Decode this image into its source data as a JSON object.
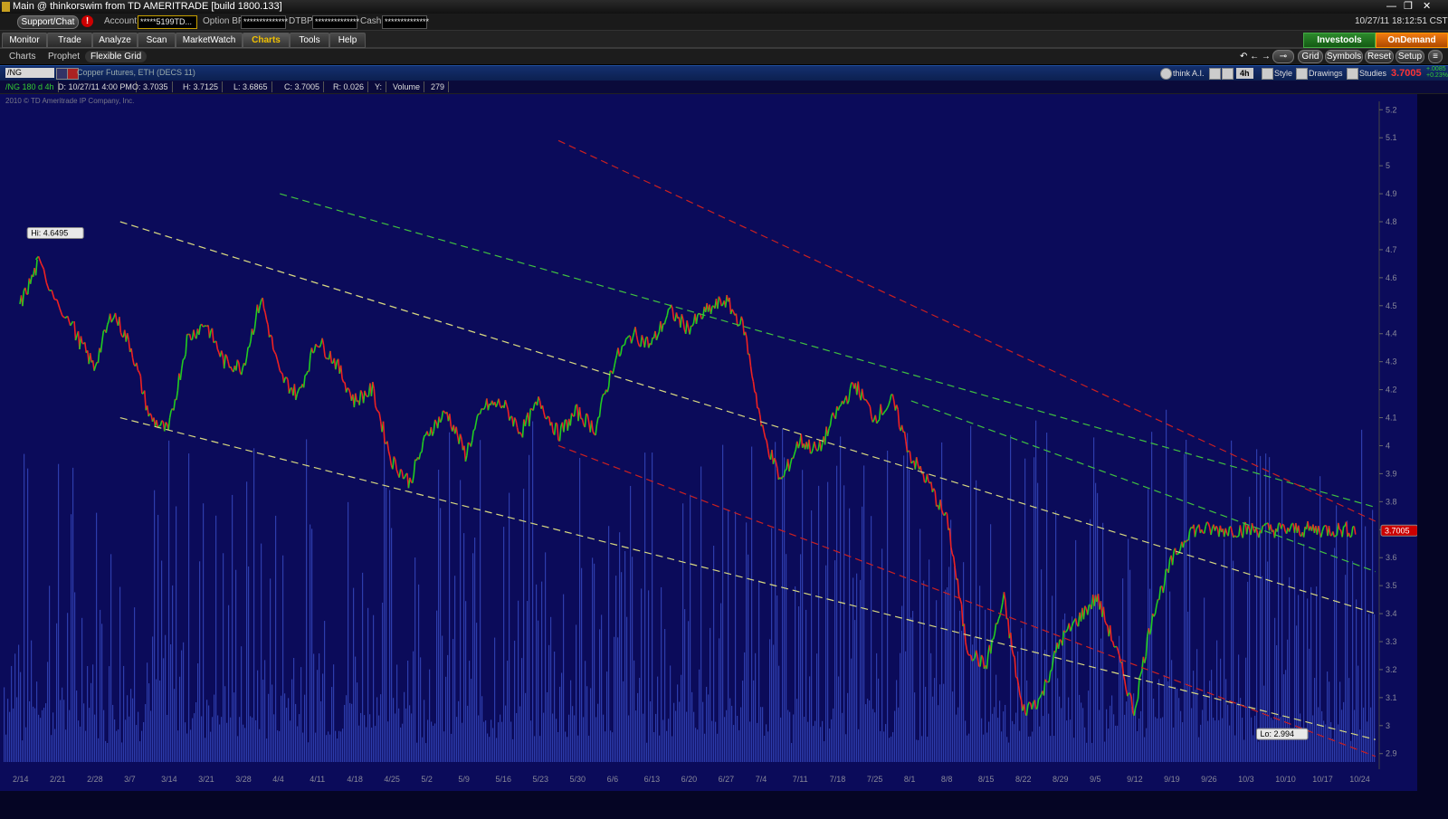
{
  "window": {
    "title": "Main @ thinkorswim from TD AMERITRADE [build 1800.133]",
    "controls": [
      "—",
      "❐",
      "✕"
    ]
  },
  "account_bar": {
    "support_label": "Support/Chat",
    "alert_badge": "!",
    "account_label": "Account",
    "account_value": "*****5199TD...",
    "option_bp_label": "Option BP",
    "option_bp_value": "**************",
    "dtbp_label": "DTBP",
    "dtbp_value": "**************",
    "cash_label": "Cash",
    "cash_value": "**************",
    "clock": "10/27/11 18:12:51 CST"
  },
  "nav": {
    "tabs": [
      "Monitor",
      "Trade",
      "Analyze",
      "Scan",
      "MarketWatch",
      "Charts",
      "Tools",
      "Help"
    ],
    "active_tab": "Charts",
    "investools": "Investools",
    "ondemand": "OnDemand"
  },
  "subnav": {
    "items": [
      "Charts",
      "Prophet",
      "Flexible Grid"
    ],
    "active": "Flexible Grid",
    "right_buttons": [
      "Grid",
      "Symbols",
      "Reset",
      "Setup"
    ]
  },
  "symbol_bar": {
    "symbol": "/NG",
    "description": "Copper Futures, ETH (DECS 11)",
    "think_ai": "think A.I.",
    "interval": "4h",
    "style": "Style",
    "drawings": "Drawings",
    "studies": "Studies",
    "last_price": "3.7005",
    "change_top": "+.0085",
    "change_bottom": "+0.23%"
  },
  "info_bar": {
    "series": "/NG 180 d 4h",
    "date": "D: 10/27/11 4:00 PM",
    "open": "O: 3.7035",
    "high": "H: 3.7125",
    "low": "L: 3.6865",
    "close": "C: 3.7005",
    "range": "R: 0.026",
    "y": "Y:",
    "volume_label": "Volume",
    "volume_value": "279"
  },
  "chart_meta": {
    "copyright": "2010 © TD Ameritrade IP Company, Inc.",
    "hi_label": "Hi: 4.6495",
    "lo_label": "Lo: 2.994",
    "last_tag": "3.7005",
    "colors": {
      "background": "#0b0b5a",
      "up": "#22cc22",
      "down": "#ee2222",
      "volume": "#3a4fc8",
      "trend_yellow": "#d8d880",
      "trend_red": "#cc2020",
      "trend_green": "#40c040"
    }
  },
  "chart_data": {
    "type": "line",
    "title": "",
    "x_labels": [
      "2/14",
      "2/21",
      "2/28",
      "3/7",
      "3/14",
      "3/21",
      "3/28",
      "4/4",
      "4/11",
      "4/18",
      "4/25",
      "5/2",
      "5/9",
      "5/16",
      "5/23",
      "5/30",
      "6/6",
      "6/13",
      "6/20",
      "6/27",
      "7/4",
      "7/11",
      "7/18",
      "7/25",
      "8/1",
      "8/8",
      "8/15",
      "8/22",
      "8/29",
      "9/5",
      "9/12",
      "9/19",
      "9/26",
      "10/3",
      "10/10",
      "10/17",
      "10/24"
    ],
    "y_ticks": [
      2.9,
      3,
      3.1,
      3.2,
      3.3,
      3.4,
      3.5,
      3.6,
      3.7,
      3.8,
      3.9,
      4,
      4.1,
      4.2,
      4.3,
      4.4,
      4.5,
      4.6,
      4.7,
      4.8,
      4.9,
      5,
      5.1,
      5.2
    ],
    "ylim": [
      2.87,
      5.23
    ],
    "series": [
      {
        "x": [
          0,
          0.5,
          1.5,
          2,
          2.5,
          3,
          3.5,
          4,
          4.5,
          5,
          5.5,
          6,
          6.5,
          7,
          7.5,
          8,
          8.5,
          9,
          9.5,
          10,
          10.5,
          11,
          11.5,
          12,
          12.5,
          13,
          13.5,
          14,
          14.5,
          15,
          15.5,
          16,
          16.5,
          17,
          17.5,
          18,
          18.5,
          19,
          19.5,
          20,
          20.5,
          21,
          21.5,
          22,
          22.5,
          23,
          23.5,
          24,
          24.5,
          25,
          25.5,
          26,
          26.5,
          27,
          27.5,
          28,
          28.5,
          29,
          29.5,
          30,
          30.5,
          31,
          31.5,
          32,
          32.5,
          33,
          33.5,
          34,
          34.5,
          35,
          35.5,
          36,
          36.5
        ],
        "y": [
          4.5,
          4.65,
          4.4,
          4.28,
          4.48,
          4.35,
          4.1,
          4.05,
          4.38,
          4.44,
          4.3,
          4.28,
          4.53,
          4.25,
          4.18,
          4.38,
          4.3,
          4.16,
          4.2,
          3.95,
          3.87,
          4.05,
          4.12,
          3.97,
          4.14,
          4.15,
          4.05,
          4.16,
          4.04,
          4.12,
          4.06,
          4.3,
          4.4,
          4.36,
          4.48,
          4.42,
          4.48,
          4.52,
          4.42,
          4.05,
          3.87,
          4.02,
          3.98,
          4.12,
          4.22,
          4.1,
          4.16,
          3.96,
          3.86,
          3.72,
          3.28,
          3.21,
          3.45,
          3.05,
          3.1,
          3.3,
          3.38,
          3.46,
          3.28,
          3.05,
          3.4,
          3.58,
          3.7,
          3.7,
          3.7,
          3.7,
          3.7,
          3.7,
          3.7,
          3.7,
          3.7,
          3.7,
          3.7
        ]
      }
    ],
    "volume_max": 600,
    "grid": false,
    "axis_side": "right"
  }
}
